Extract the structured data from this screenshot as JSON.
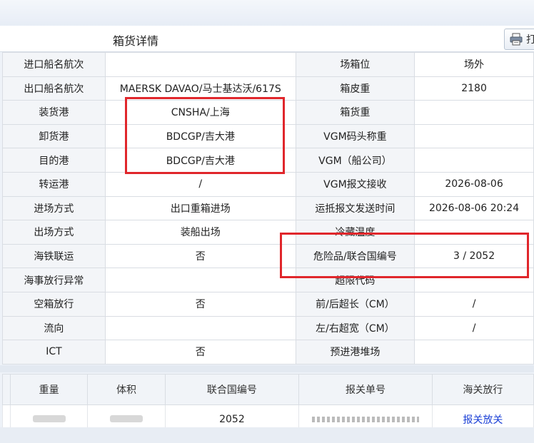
{
  "header": {
    "title": "箱货详情",
    "print_label": "打"
  },
  "detail_rows": [
    [
      "进口船名航次",
      "",
      "场箱位",
      "场外"
    ],
    [
      "出口船名航次",
      "MAERSK DAVAO/马士基达沃/617S",
      "箱皮重",
      "2180"
    ],
    [
      "装货港",
      "CNSHA/上海",
      "箱货重",
      ""
    ],
    [
      "卸货港",
      "BDCGP/吉大港",
      "VGM码头称重",
      ""
    ],
    [
      "目的港",
      "BDCGP/吉大港",
      "VGM（船公司）",
      ""
    ],
    [
      "转运港",
      "/",
      "VGM报文接收",
      "2026-08-06"
    ],
    [
      "进场方式",
      "出口重箱进场",
      "运抵报文发送时间",
      "2026-08-06 20:24"
    ],
    [
      "出场方式",
      "装船出场",
      "冷藏温度",
      ""
    ],
    [
      "海铁联运",
      "否",
      "危险品/联合国编号",
      "3 / 2052"
    ],
    [
      "海事放行异常",
      "",
      "超限代码",
      ""
    ],
    [
      "空箱放行",
      "否",
      "前/后超长（CM）",
      "/"
    ],
    [
      "流向",
      "",
      "左/右超宽（CM）",
      "/"
    ],
    [
      "ICT",
      "否",
      "预进港堆场",
      ""
    ]
  ],
  "cargo_table": {
    "headers": [
      "重量",
      "体积",
      "联合国编号",
      "报关单号",
      "海关放行"
    ],
    "row": {
      "un_no": "2052",
      "customs_release": "报关放关"
    }
  },
  "colors": {
    "highlight": "#e0262b",
    "link": "#1a3fd6"
  }
}
